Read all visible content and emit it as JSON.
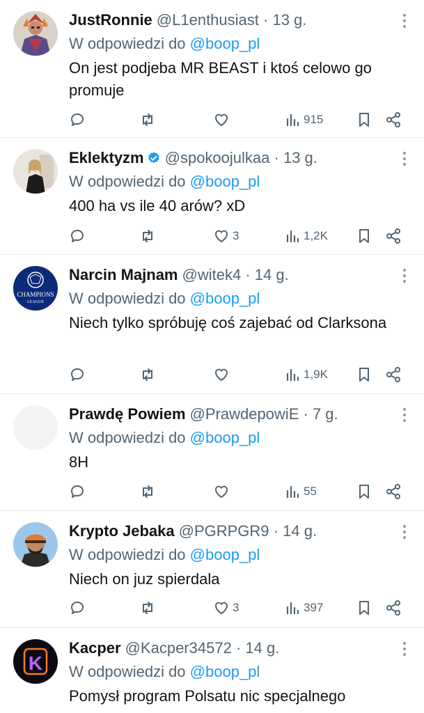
{
  "reply_prefix": "W odpowiedzi do",
  "tweets": [
    {
      "name": "JustRonnie",
      "verified": false,
      "handle": "@L1enthusiast",
      "dot": "·",
      "time": "13 g.",
      "reply_to": "@boop_pl",
      "text": "On jest podjeba MR BEAST i ktoś celowo go promuje",
      "replies": "",
      "retweets": "",
      "likes": "",
      "views": "915",
      "avatar_icon": "fantasy-warrior-avatar"
    },
    {
      "name": "Eklektyzm",
      "verified": true,
      "handle": "@spokoojulkaa",
      "dot": "·",
      "time": "13 g.",
      "reply_to": "@boop_pl",
      "text": "400 ha vs ile 40 arów? xD",
      "replies": "",
      "retweets": "",
      "likes": "3",
      "views": "1,2K",
      "avatar_icon": "woman-photo-avatar"
    },
    {
      "name": "Narcin Majnam",
      "verified": false,
      "handle": "@witek4",
      "dot": "·",
      "time": "14 g.",
      "reply_to": "@boop_pl",
      "text": "Niech tylko spróbuję coś zajebać od Clarksona",
      "replies": "",
      "retweets": "",
      "likes": "",
      "views": "1,9K",
      "avatar_icon": "champions-league-logo-avatar",
      "avatar_text": [
        "CHAMPIONS",
        "LEAGUE"
      ]
    },
    {
      "name": "Prawdę Powiem",
      "verified": false,
      "handle": "@PrawdepowiE",
      "dot": "·",
      "time": "7 g.",
      "reply_to": "@boop_pl",
      "text": "8H",
      "replies": "",
      "retweets": "",
      "likes": "",
      "views": "55",
      "avatar_icon": "blank-avatar"
    },
    {
      "name": "Krypto Jebaka",
      "verified": false,
      "handle": "@PGRPGR9",
      "dot": "·",
      "time": "14 g.",
      "reply_to": "@boop_pl",
      "text": "Niech on juz spierdala",
      "replies": "",
      "retweets": "",
      "likes": "3",
      "views": "397",
      "avatar_icon": "man-with-cap-avatar"
    },
    {
      "name": "Kacper",
      "verified": false,
      "handle": "@Kacper34572",
      "dot": "·",
      "time": "14 g.",
      "reply_to": "@boop_pl",
      "text": "Pomysł program Polsatu nic specjalnego",
      "replies": "",
      "retweets": "",
      "likes": "",
      "views": "",
      "avatar_icon": "neon-k-avatar",
      "avatar_text": [
        "K"
      ]
    }
  ],
  "colors": {
    "text": "#0f1419",
    "secondary": "#536471",
    "link": "#1d9bf0",
    "divider": "#e6e9ec",
    "verified": "#1d9bf0"
  }
}
